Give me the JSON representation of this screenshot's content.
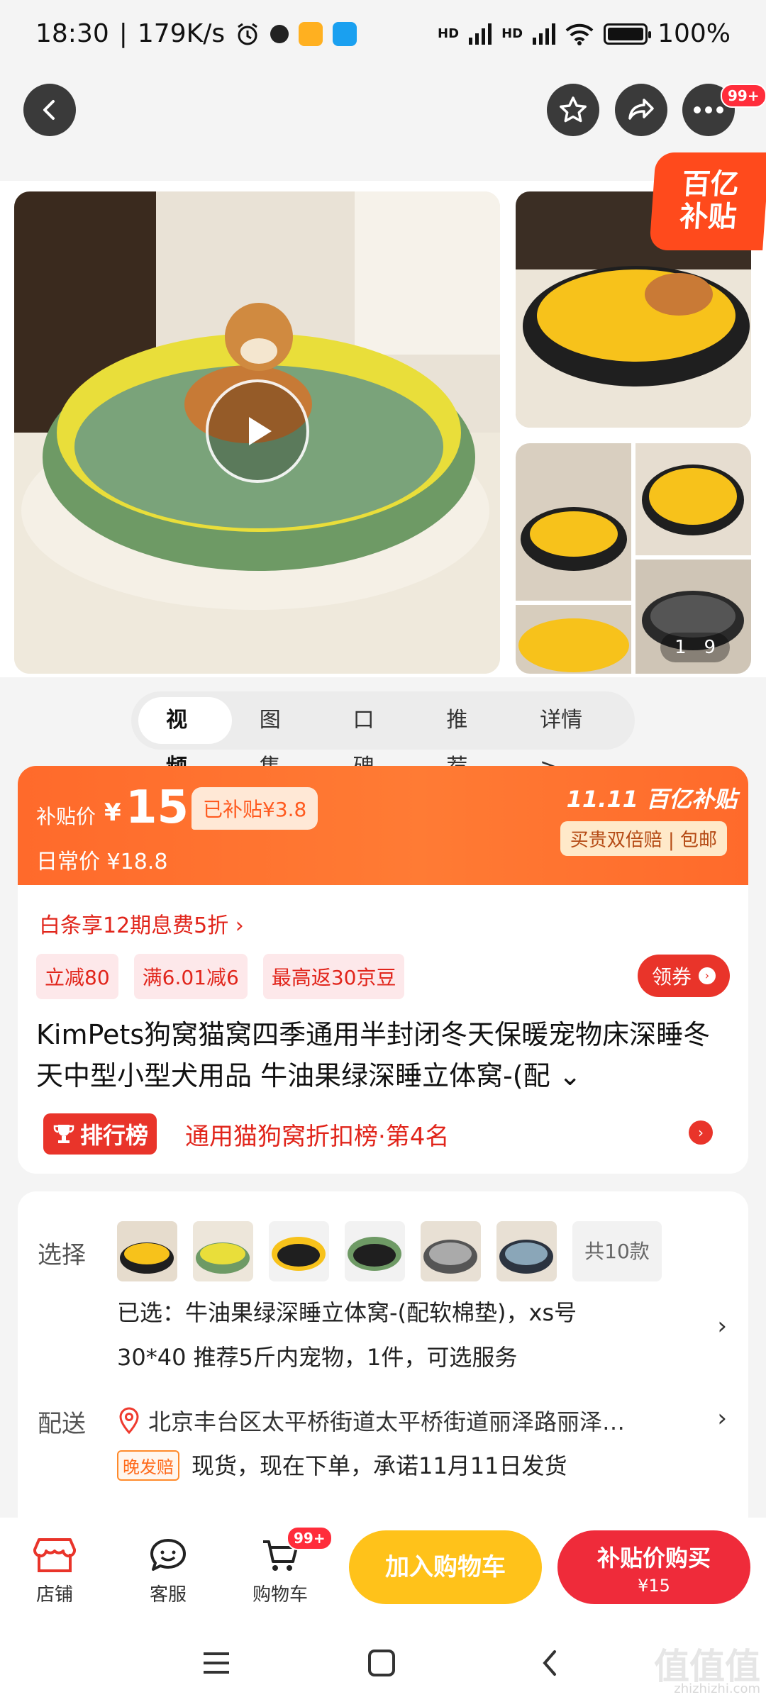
{
  "status_bar": {
    "time": "18:30",
    "speed": "179K/s",
    "network1": "HD",
    "network2": "HD",
    "battery": "100%"
  },
  "nav": {
    "more_badge": "99+"
  },
  "gallery": {
    "counter_current": "1",
    "counter_total": "9",
    "subsidy_line1": "百亿",
    "subsidy_line2": "补贴"
  },
  "tabs": [
    "视频",
    "图集",
    "口碑",
    "推荐",
    "详情 >"
  ],
  "price": {
    "subsidy_label": "补贴价",
    "currency": "¥",
    "amount": "15",
    "subsidized": "已补贴¥3.8",
    "daily_label": "日常价",
    "daily_price": "¥18.8",
    "activity": "11.11 百亿补贴",
    "guarantee": "买贵双倍赔 | 包邮"
  },
  "credit": "白条享12期息费5折 ›",
  "coupons": [
    "立减80",
    "满6.01减6",
    "最高返30京豆"
  ],
  "get_coupon": "领券",
  "product_title": "KimPets狗窝猫窝四季通用半封闭冬天保暖宠物床深睡冬天中型小型犬用品 牛油果绿深睡立体窝-(配 ⌄",
  "rank": {
    "badge": "排行榜",
    "text": "通用猫狗窝折扣榜·第4名"
  },
  "select": {
    "label": "选择",
    "more": "共10款",
    "selected_line1": "已选：牛油果绿深睡立体窝-(配软棉垫)，xs号",
    "selected_line2": "30*40 推荐5斤内宠物，1件，可选服务"
  },
  "delivery": {
    "label": "配送",
    "address": "北京丰台区太平桥街道太平桥街道丽泽路丽泽…",
    "late_pay": "晚发赔",
    "ship_text": "现货，现在下单，承诺11月11日发货"
  },
  "bottom_bar": {
    "shop": "店铺",
    "service": "客服",
    "cart": "购物车",
    "cart_badge": "99+",
    "add_cart": "加入购物车",
    "buy_line1": "补贴价购买",
    "buy_line2": "¥15"
  },
  "watermark": {
    "main": "值值值",
    "sub": "zhizhizhi.com"
  },
  "colors": {
    "accent_red": "#e9342a",
    "accent_orange": "#ff6a2b",
    "cart_yellow": "#ffc21a"
  }
}
